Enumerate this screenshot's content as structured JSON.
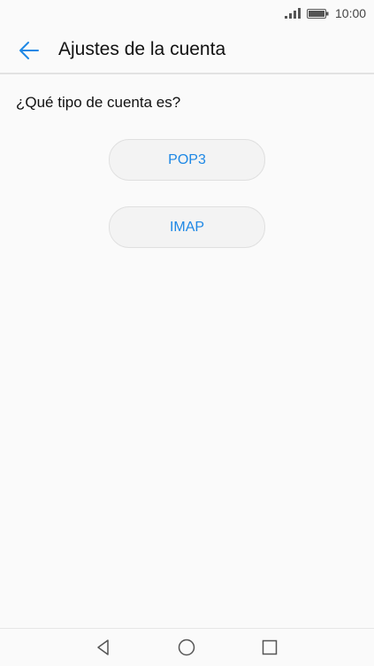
{
  "status_bar": {
    "time": "10:00",
    "signal_icon": "signal-icon",
    "battery_icon": "battery-icon"
  },
  "app_bar": {
    "back_icon": "arrow-left-icon",
    "title": "Ajustes de la cuenta"
  },
  "main": {
    "question": "¿Qué tipo de cuenta es?",
    "options": [
      {
        "label": "POP3"
      },
      {
        "label": "IMAP"
      }
    ]
  },
  "nav_bar": {
    "back_icon": "triangle-back-icon",
    "home_icon": "circle-home-icon",
    "recents_icon": "square-recents-icon"
  },
  "colors": {
    "accent": "#1e88e5",
    "background": "#fafafa",
    "button_bg": "#f3f3f3"
  }
}
